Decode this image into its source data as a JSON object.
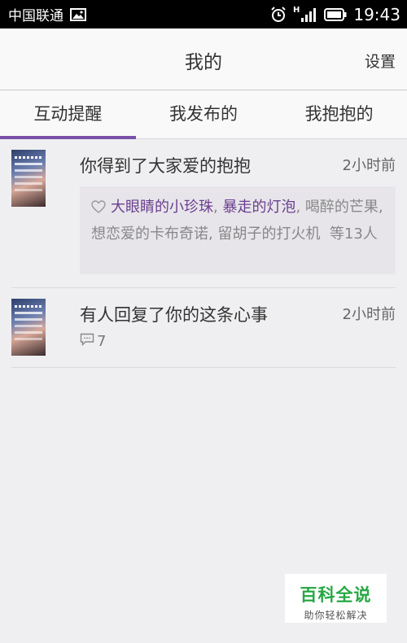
{
  "status_bar": {
    "carrier": "中国联通",
    "network_type": "H",
    "time": "19:43"
  },
  "header": {
    "title": "我的",
    "settings_label": "设置"
  },
  "tabs": [
    {
      "label": "互动提醒",
      "active": true
    },
    {
      "label": "我发布的",
      "active": false
    },
    {
      "label": "我抱抱的",
      "active": false
    }
  ],
  "items": [
    {
      "title": "你得到了大家爱的抱抱",
      "time": "2小时前",
      "likers": [
        "大眼睛的小珍珠",
        "暴走的灯泡",
        "喝醉的芒果",
        "想恋爱的卡布奇诺",
        "留胡子的打火机"
      ],
      "likers_suffix": "等13人"
    },
    {
      "title": "有人回复了你的这条心事",
      "time": "2小时前",
      "comment_count": "7"
    }
  ],
  "watermark": {
    "title": "百科全说",
    "subtitle": "助你轻松解决"
  },
  "colors": {
    "accent": "#7a50a8",
    "liker_name": "#6b3f8f",
    "watermark_green": "#27a844"
  }
}
